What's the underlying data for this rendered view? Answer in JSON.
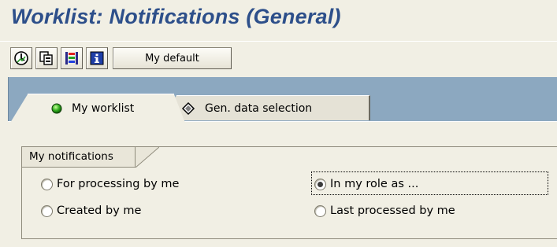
{
  "page": {
    "title": "Worklist: Notifications (General)"
  },
  "toolbar": {
    "buttons": [
      {
        "icon": "clock-execute-icon"
      },
      {
        "icon": "copy-variant-icon"
      },
      {
        "icon": "color-legend-icon"
      },
      {
        "icon": "info-icon"
      }
    ],
    "my_default_label": "My default"
  },
  "tabs": [
    {
      "label": "My worklist",
      "icon": "green-light-icon",
      "active": true
    },
    {
      "label": "Gen. data selection",
      "icon": "diamond-icon",
      "active": false
    }
  ],
  "group": {
    "title": "My notifications",
    "options": [
      {
        "label": "For processing by me",
        "checked": false
      },
      {
        "label": "In my role as ...",
        "checked": true
      },
      {
        "label": "Created by me",
        "checked": false
      },
      {
        "label": "Last processed by me",
        "checked": false
      }
    ]
  },
  "colors": {
    "title": "#2d4f8a",
    "panel": "#8ca8c0",
    "background": "#f1efe4"
  }
}
